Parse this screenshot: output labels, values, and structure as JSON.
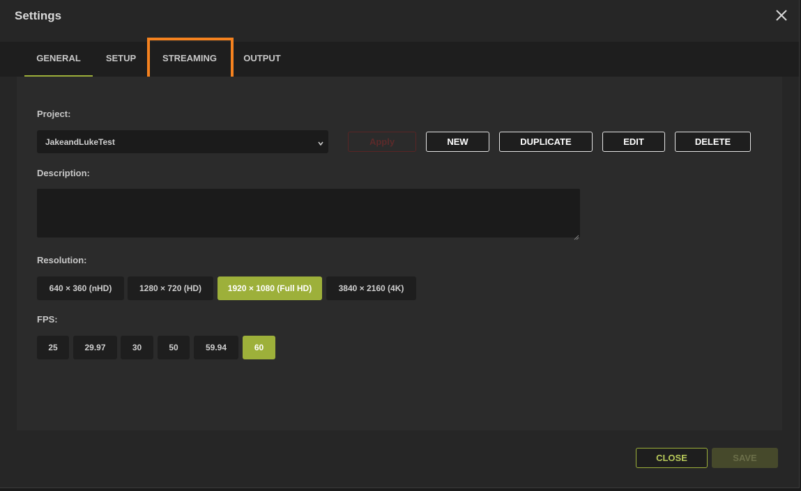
{
  "dialog": {
    "title": "Settings",
    "close_icon": "close-icon"
  },
  "tabs": [
    {
      "label": "GENERAL",
      "active": true
    },
    {
      "label": "SETUP",
      "active": false
    },
    {
      "label": "STREAMING",
      "active": false,
      "highlighted": true
    },
    {
      "label": "OUTPUT",
      "active": false
    }
  ],
  "project": {
    "label": "Project:",
    "selected": "JakeandLukeTest",
    "apply_label": "Apply",
    "new_label": "NEW",
    "duplicate_label": "DUPLICATE",
    "edit_label": "EDIT",
    "delete_label": "DELETE"
  },
  "description": {
    "label": "Description:",
    "value": ""
  },
  "resolution": {
    "label": "Resolution:",
    "options": [
      "640 × 360 (nHD)",
      "1280 × 720 (HD)",
      "1920 × 1080 (Full HD)",
      "3840 × 2160 (4K)"
    ],
    "selected": "1920 × 1080 (Full HD)"
  },
  "fps": {
    "label": "FPS:",
    "options": [
      "25",
      "29.97",
      "30",
      "50",
      "59.94",
      "60"
    ],
    "selected": "60"
  },
  "footer": {
    "close_label": "CLOSE",
    "save_label": "SAVE"
  },
  "colors": {
    "accent": "#9db03a",
    "highlight": "#f5821f",
    "background": "#262626"
  }
}
